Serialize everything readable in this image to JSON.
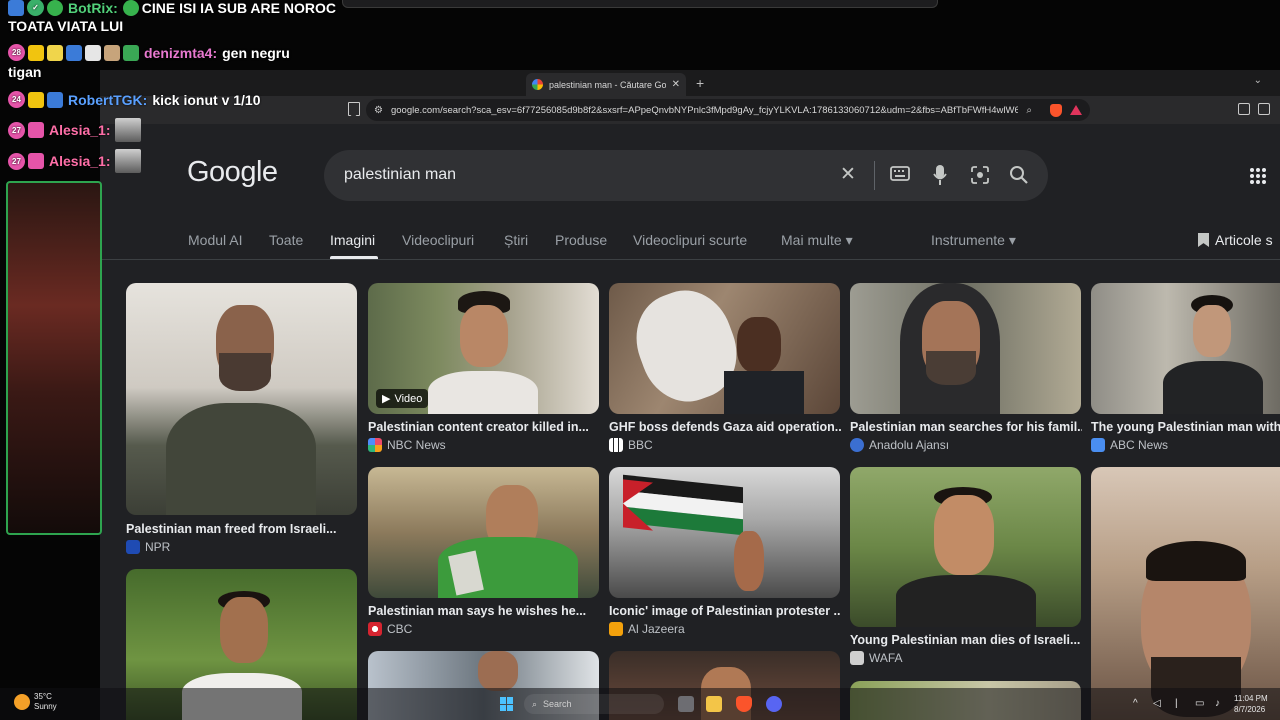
{
  "chat": {
    "lines": [
      {
        "user": "BotRix:",
        "user_color": "#52d17a",
        "message": "CINE ISI IA SUB ARE NOROC",
        "message2": "TOATA VIATA LUI"
      },
      {
        "badge": "28",
        "user": "denizmta4:",
        "user_color": "#e879d0",
        "message": "gen negru",
        "message2": "tigan"
      },
      {
        "badge": "24",
        "user": "RobertTGK:",
        "user_color": "#5aa0ff",
        "message": "kick ionut v 1/10"
      },
      {
        "badge": "27",
        "user": "Alesia_1:",
        "user_color": "#ff6fa8"
      },
      {
        "badge": "27",
        "user": "Alesia_1:",
        "user_color": "#ff6fa8"
      }
    ]
  },
  "browser": {
    "tab_title": "palestinian man - Căutare Googl",
    "tab_close": "✕",
    "new_tab": "+",
    "tab_menu": "⌄",
    "url": "google.com/search?sca_esv=6f77256085d9b8f2&sxsrf=APpeQnvbNYPnlc3fMpd9gAy_fcjyYLKVLA:1786133060712&udm=2&fbs=ABfTbFWfH4wlW6..."
  },
  "google": {
    "logo": "Google",
    "query": "palestinian man",
    "clear_icon": "✕",
    "tabs": [
      {
        "label": "Modul AI"
      },
      {
        "label": "Toate"
      },
      {
        "label": "Imagini"
      },
      {
        "label": "Videoclipuri"
      },
      {
        "label": "Știri"
      },
      {
        "label": "Produse"
      },
      {
        "label": "Videoclipuri scurte"
      },
      {
        "label": "Mai multe ▾"
      },
      {
        "label": "Instrumente ▾"
      }
    ],
    "saved": "Articole s"
  },
  "results": [
    {
      "title": "Palestinian man freed from Israeli...",
      "source": "NPR",
      "src_color": "#1f4bb3"
    },
    {
      "title": "Palestinian content creator killed in...",
      "source": "NBC News",
      "src_color": "#ec4b6a",
      "video": "Video"
    },
    {
      "title": "GHF boss defends Gaza aid operation...",
      "source": "BBC",
      "src_color": "#ffffff"
    },
    {
      "title": "Palestinian man searches for his famil...",
      "source": "Anadolu Ajansı",
      "src_color": "#3b6fd1"
    },
    {
      "title": "The young Palestinian man with",
      "source": "ABC News",
      "src_color": "#4a8ef0"
    },
    {
      "title": "Palestinian man says he wishes he...",
      "source": "CBC",
      "src_color": "#d62430"
    },
    {
      "title": "Iconic' image of Palestinian protester ...",
      "source": "Al Jazeera",
      "src_color": "#f3a10c"
    },
    {
      "title": "Young Palestinian man dies of Israeli...",
      "source": "WAFA",
      "src_color": "#cfcfcf"
    }
  ],
  "taskbar": {
    "temp": "35°C",
    "weather": "Sunny",
    "search_placeholder": "Search",
    "time": "11:04 PM",
    "date": "8/7/2026"
  }
}
